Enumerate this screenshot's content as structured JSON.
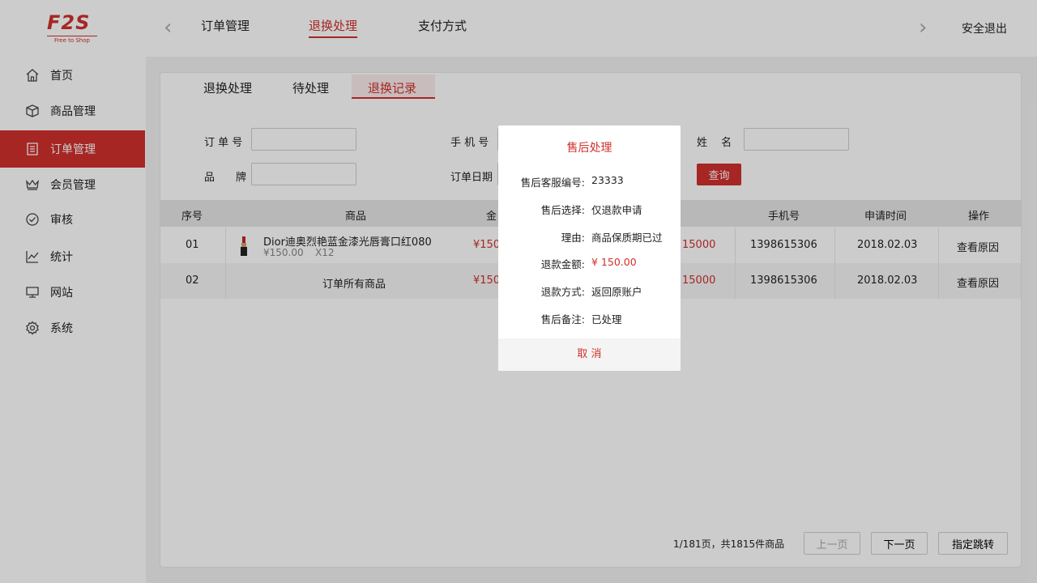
{
  "brand": {
    "logo_text": "F2S",
    "tagline": "Free to Shop"
  },
  "header": {
    "tabs": [
      {
        "label": "订单管理"
      },
      {
        "label": "退换处理"
      },
      {
        "label": "支付方式"
      }
    ],
    "logout": "安全退出"
  },
  "sidebar": {
    "items": [
      {
        "label": "首页",
        "icon": "home-icon"
      },
      {
        "label": "商品管理",
        "icon": "box-icon"
      },
      {
        "label": "订单管理",
        "icon": "document-icon"
      },
      {
        "label": "会员管理",
        "icon": "crown-icon"
      },
      {
        "label": "审核",
        "icon": "check-circle-icon"
      },
      {
        "label": "统计",
        "icon": "chart-line-icon"
      },
      {
        "label": "网站",
        "icon": "monitor-icon"
      },
      {
        "label": "系统",
        "icon": "gear-icon"
      }
    ]
  },
  "subtabs": [
    {
      "label": "退换处理"
    },
    {
      "label": "待处理"
    },
    {
      "label": "退换记录"
    }
  ],
  "filters": {
    "order_no": "订 单 号",
    "phone": "手 机 号",
    "name": "姓　 名",
    "brand": "品　　牌",
    "order_date": "订单日期",
    "query_btn": "查询"
  },
  "table": {
    "headers": [
      "序号",
      "商品",
      "金",
      "手机号",
      "申请时间",
      "操作"
    ],
    "rows": [
      {
        "no": "01",
        "product_name": "Dior迪奥烈艳蓝金漆光唇膏口红080",
        "product_price": "¥150.00",
        "product_qty": "X12",
        "amount_partial": "¥150",
        "amount_tail": "15000",
        "phone": "1398615306",
        "date": "2018.02.03",
        "action": "查看原因"
      },
      {
        "no": "02",
        "product_name": "订单所有商品",
        "amount_partial": "¥150",
        "amount_tail": "15000",
        "phone": "1398615306",
        "date": "2018.02.03",
        "action": "查看原因"
      }
    ]
  },
  "pager": {
    "info": "1/181页，共1815件商品",
    "prev": "上一页",
    "next": "下一页",
    "jump": "指定跳转"
  },
  "modal": {
    "title": "售后处理",
    "fields": [
      {
        "label": "售后客服编号:",
        "value": "23333"
      },
      {
        "label": "售后选择:",
        "value": "仅退款申请"
      },
      {
        "label": "理由:",
        "value": "商品保质期已过"
      },
      {
        "label": "退款金额:",
        "value": "¥ 150.00"
      },
      {
        "label": "退款方式:",
        "value": "返回原账户"
      },
      {
        "label": "售后备注:",
        "value": "已处理"
      }
    ],
    "cancel": "取 消"
  },
  "colors": {
    "accent": "#d0302c"
  }
}
